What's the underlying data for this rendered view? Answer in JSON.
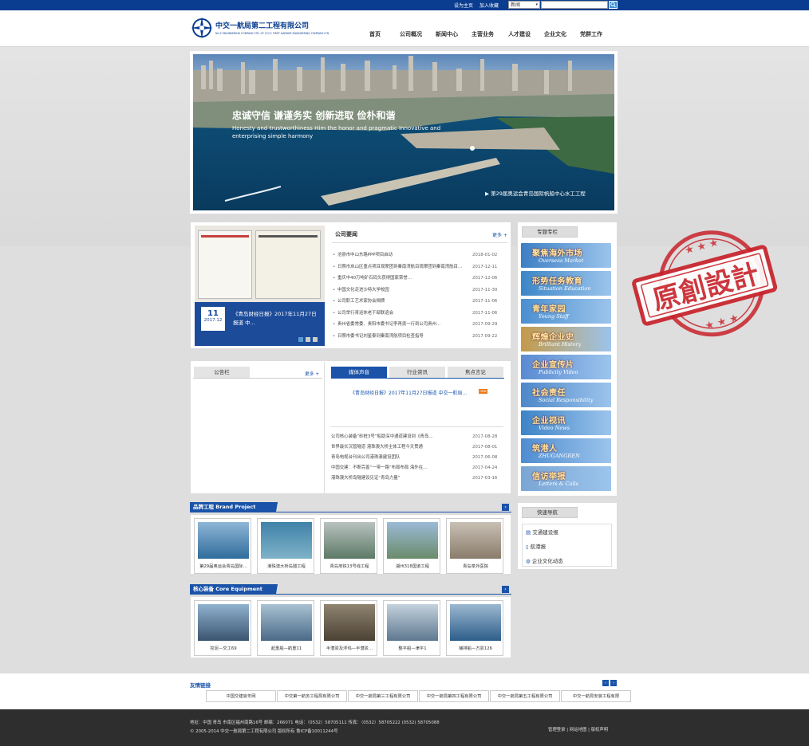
{
  "topbar": {
    "set_home": "设为主页",
    "add_fav": "加入收藏",
    "search_select": "新闻",
    "search_placeholder": ""
  },
  "logo": {
    "name_cn": "中交一航局第二工程有限公司",
    "name_en": "NO.2 ENGINEERING COMPANY LTD. OF CCCC FIRST HARBOR ENGINEERING COMPANY LTD."
  },
  "nav": [
    "首页",
    "公司概况",
    "新闻中心",
    "主营业务",
    "人才建设",
    "企业文化",
    "党群工作"
  ],
  "hero": {
    "slogan_cn": "忠诚守信 谦谨务实  创新进取 俭朴和谐",
    "slogan_en": "Honesty and trustworthiness Him the honor and pragmatic Innovative and enterprising simple harmony",
    "caption": "第29届奥运会青岛国际帆船中心水工工程"
  },
  "company_news": {
    "title": "公司要闻",
    "more": "更多 +",
    "feature_day": "11",
    "feature_ym": "2017.12",
    "feature_title": "《青岛财经日报》2017年11月27日报道 中...",
    "items": [
      {
        "t": "沧县市中山东路PPP项目启动",
        "d": "2018-01-02"
      },
      {
        "t": "日照市岚山区重点项目观摩团到秦南湾航目观摩团到秦南湾航目…",
        "d": "2017-12-11"
      },
      {
        "t": "重庆中40万吨矿石码头获得国家荣誉…",
        "d": "2017-12-06"
      },
      {
        "t": "中国文化走进沙特大学校园",
        "d": "2017-11-30"
      },
      {
        "t": "公司职工艺术家协会揭牌",
        "d": "2017-11-06"
      },
      {
        "t": "公司举行青运休老干部联谊会",
        "d": "2017-11-06"
      },
      {
        "t": "贵州省委常委、贵阳市委书记李再勇一行到公司贵州…",
        "d": "2017-09-29"
      },
      {
        "t": "日照市委书记刘星泰到秦南湾航项目检查指导",
        "d": "2017-09-22"
      }
    ]
  },
  "notice": {
    "title": "公告栏",
    "more": "更多 +"
  },
  "media": {
    "tabs": [
      "媒体声音",
      "行业资讯",
      "焦点言论"
    ],
    "headline": "《青岛财经日报》2017年11月27日报道 中交一航局…",
    "items": [
      {
        "t": "公司核心装备“砂桩3号”船助深中通道建设到《青岛…",
        "d": "2017-08-28"
      },
      {
        "t": "世界最长沉管隧道 港珠澳大桥主体工程今天贯通",
        "d": "2017-08-01"
      },
      {
        "t": "青岛电视台刊出公司港珠澳建设团队",
        "d": "2017-06-08"
      },
      {
        "t": "中国交建：不断完善“一带一路”布局布局 海外在…",
        "d": "2017-04-24"
      },
      {
        "t": "港珠澳大桥岛隧建设见证“青岛力量”",
        "d": "2017-03-16"
      }
    ]
  },
  "special": {
    "title": "专题专栏",
    "banners": [
      {
        "cn": "聚焦海外市场",
        "en": "Overseas Market"
      },
      {
        "cn": "形势任务教育",
        "en": "Situation Education"
      },
      {
        "cn": "青年家园",
        "en": "Young Staff"
      },
      {
        "cn": "辉煌企业史",
        "en": "Brilliant History"
      },
      {
        "cn": "企业宣传片",
        "en": "Publicity Video"
      },
      {
        "cn": "社会责任",
        "en": "Social Responsibility"
      },
      {
        "cn": "企业视讯",
        "en": "Video News"
      },
      {
        "cn": "筑港人",
        "en": "ZHUGANGREN"
      },
      {
        "cn": "信访举报",
        "en": "Letters & Calls"
      }
    ]
  },
  "quicknav": {
    "title": "快速导航",
    "items": [
      "交通建设报",
      "航港报",
      "企业文化动态"
    ]
  },
  "brand": {
    "title": "品牌工程 Brand Project",
    "items": [
      "第29届奥运会青岛国际…",
      "港珠澳大桥岛隧工程",
      "青岛地铁13号线工程",
      "湖州318国道工程",
      "青岛阜外医院"
    ]
  },
  "equipment": {
    "title": "核心装备 Core Equipment",
    "items": [
      "挖泥—交工69",
      "起重船—航重11",
      "半潜驳及浮坞—半潜驳…",
      "整平船—津平1",
      "铺排船—方驳126"
    ]
  },
  "friends": {
    "title": "友情链接",
    "items": [
      "中国交建官年网",
      "中交第一航务工程局有限公司",
      "中交一航局第三工程有限公司",
      "中交一航局第四工程有限公司",
      "中交一航局第五工程有限公司",
      "中交一航局安装工程有限"
    ]
  },
  "footer": {
    "line1": "地址：中国 青岛 市南区福州南路16号 邮编：266071 电话：（0532）58705111 传真：（0532）58705222 (0532) 58705088",
    "line2": "© 2005-2014 中交一航局第二工程有限公司 版权所有 鲁ICP备10011244号",
    "links": "管理登录 | 网站地图 | 版权声明"
  },
  "stamp": "原創設計",
  "colors": {
    "primary": "#0a3d8f",
    "accent": "#1a53a8",
    "stamp": "#c8222a"
  }
}
